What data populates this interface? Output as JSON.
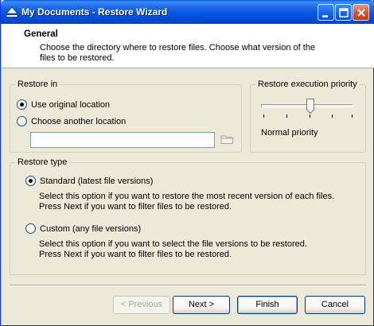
{
  "window": {
    "title": "My Documents - Restore Wizard",
    "icon": "eject-icon",
    "accent": "#0055e3"
  },
  "header": {
    "title": "General",
    "description": "Choose the directory where to restore files. Choose what version of the files to be restored."
  },
  "restore_in": {
    "legend": "Restore in",
    "option_original": "Use original location",
    "option_another": "Choose another location",
    "selected": "original",
    "path_value": ""
  },
  "priority": {
    "legend": "Restore execution priority",
    "level_label": "Normal priority",
    "level_fraction": 0.5
  },
  "restore_type": {
    "legend": "Restore type",
    "standard_label": "Standard (latest file versions)",
    "standard_desc_1": "Select this option if you want to restore the most recent version of each files.",
    "standard_desc_2": " Press Next if you want to filter files to be restored.",
    "custom_label": "Custom (any file versions)",
    "custom_desc_1": "Select this option if you want to select the file versions to be restored.",
    "custom_desc_2": "Press Next if you want to filter files to be restored.",
    "selected": "standard"
  },
  "buttons": {
    "previous": "< Previous",
    "next": "Next >",
    "finish": "Finish",
    "cancel": "Cancel"
  }
}
